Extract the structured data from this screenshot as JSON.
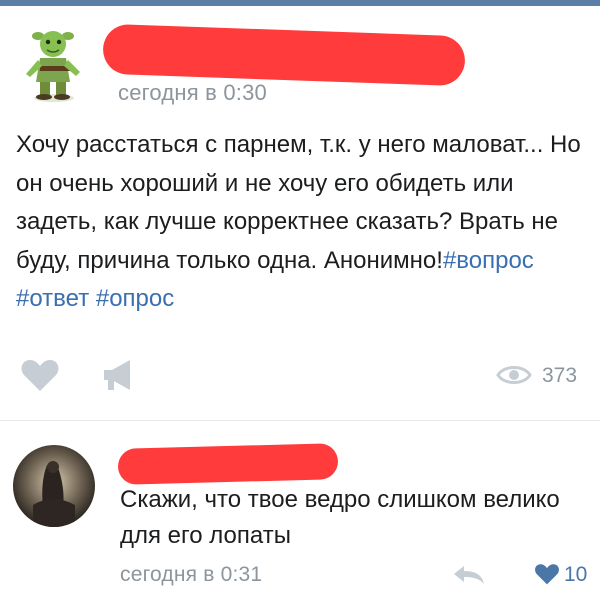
{
  "post": {
    "time": "сегодня в 0:30",
    "text": "Хочу расстаться с парнем, т.к. у него маловат... Но он очень хороший и не хочу его обидеть или задеть, как лучше корректнее сказать? Врать не буду, причина только одна. Анонимно!",
    "hashtags": [
      "#вопрос",
      "#ответ",
      "#опрос"
    ],
    "views": "373"
  },
  "comment": {
    "text": "Скажи, что твое ведро слишком велико для его лопаты",
    "time": "сегодня в 0:31",
    "likes": "10"
  },
  "icons": {
    "like": "heart-icon",
    "share": "megaphone-icon",
    "views": "eye-icon",
    "reply": "reply-arrow-icon",
    "comment_like": "heart-icon"
  },
  "colors": {
    "redaction": "#ff3b3b",
    "hashtag": "#3a6fb0",
    "meta": "#8c949c",
    "icon_gray": "#c7cdd4",
    "accent": "#4a76a8"
  }
}
